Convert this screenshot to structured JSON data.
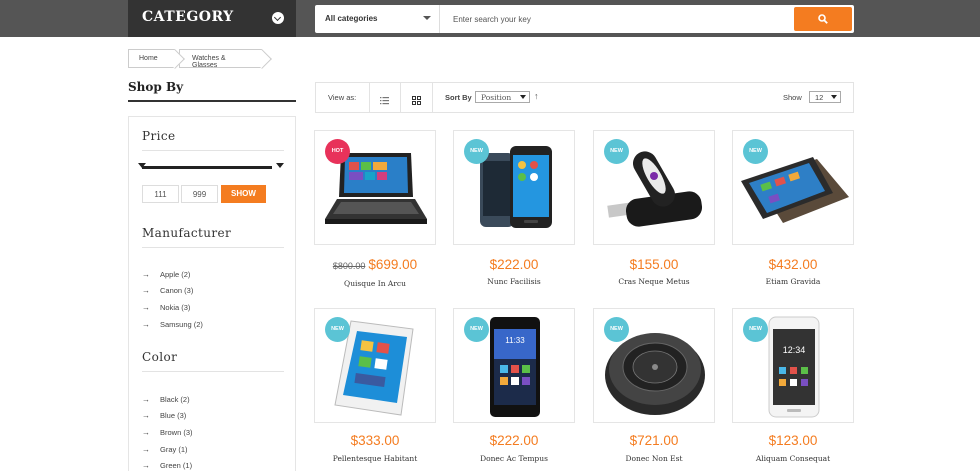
{
  "header": {
    "category_title": "CATEGORY",
    "search": {
      "category_selected": "All categories",
      "placeholder": "Enter search your key"
    }
  },
  "breadcrumb": [
    "Home",
    "Watches & Glasses"
  ],
  "sidebar": {
    "title": "Shop By",
    "price": {
      "heading": "Price",
      "min": "111",
      "max": "999",
      "button": "SHOW"
    },
    "manufacturer": {
      "heading": "Manufacturer",
      "items": [
        "Apple (2)",
        "Canon (3)",
        "Nokia (3)",
        "Samsung (2)"
      ]
    },
    "color": {
      "heading": "Color",
      "items": [
        "Black (2)",
        "Blue (3)",
        "Brown (3)",
        "Gray (1)",
        "Green (1)"
      ]
    }
  },
  "toolbar": {
    "view_as": "View as:",
    "sort_by": "Sort By",
    "sort_value": "Position",
    "sort_dir": "↑",
    "show_label": "Show",
    "show_value": "12"
  },
  "products": [
    {
      "name": "Quisque In Arcu",
      "price": "$699.00",
      "old_price": "$800.00",
      "badge": "HOT",
      "icon": "laptop-tablet-icon"
    },
    {
      "name": "Nunc Facilisis",
      "price": "$222.00",
      "badge": "NEW",
      "icon": "smartphones-icon"
    },
    {
      "name": "Cras Neque Metus",
      "price": "$155.00",
      "badge": "NEW",
      "icon": "usb-drive-icon"
    },
    {
      "name": "Etiam Gravida",
      "price": "$432.00",
      "badge": "NEW",
      "icon": "slider-tablet-icon"
    },
    {
      "name": "Pellentesque Habitant",
      "price": "$333.00",
      "badge": "NEW",
      "icon": "white-tablet-icon"
    },
    {
      "name": "Donec Ac Tempus",
      "price": "$222.00",
      "badge": "NEW",
      "icon": "black-phone-icon"
    },
    {
      "name": "Donec Non Est",
      "price": "$721.00",
      "badge": "NEW",
      "icon": "robot-vacuum-icon"
    },
    {
      "name": "Aliquam Consequat",
      "price": "$123.00",
      "badge": "NEW",
      "icon": "white-phone-icon"
    }
  ],
  "colors": {
    "accent": "#f47c20",
    "badge_new": "#5bc4d5",
    "badge_hot": "#e8325a",
    "header_bg": "#555555",
    "category_bg": "#333333"
  }
}
